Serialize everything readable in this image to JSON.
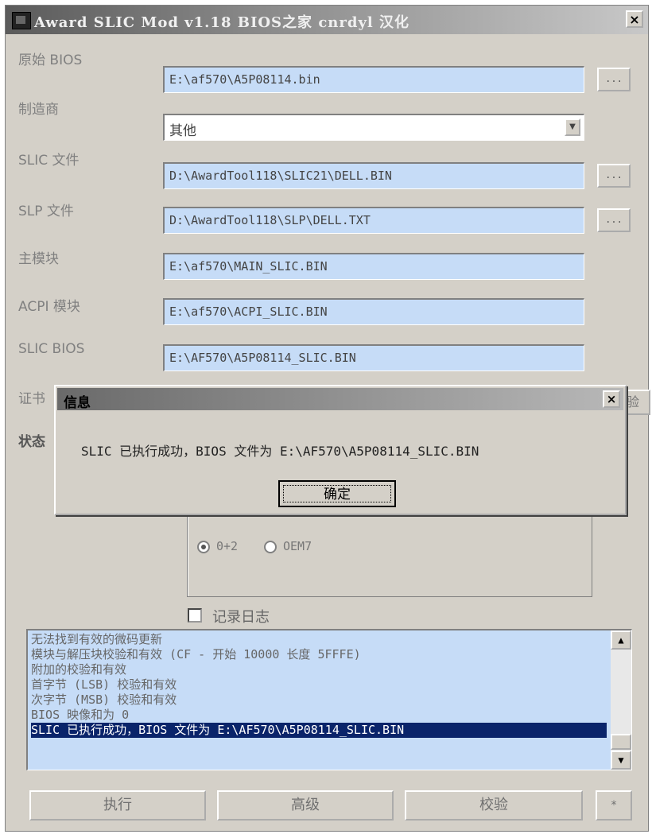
{
  "window": {
    "title": "Award SLIC Mod v1.18  BIOS之家 cnrdyl 汉化",
    "close": "×"
  },
  "fields": [
    {
      "label": "原始 BIOS",
      "value": "E:\\af570\\A5P08114.bin",
      "browse": "..."
    },
    {
      "label": "制造商",
      "value": "其他"
    },
    {
      "label": "SLIC 文件",
      "value": "D:\\AwardTool118\\SLIC21\\DELL.BIN",
      "browse": "..."
    },
    {
      "label": "SLP 文件",
      "value": "D:\\AwardTool118\\SLP\\DELL.TXT",
      "browse": "..."
    },
    {
      "label": "主模块",
      "value": "E:\\af570\\MAIN_SLIC.BIN"
    },
    {
      "label": "ACPI 模块",
      "value": "E:\\af570\\ACPI_SLIC.BIN"
    },
    {
      "label": "SLIC BIOS",
      "value": "E:\\AF570\\A5P08114_SLIC.BIN"
    }
  ],
  "partial_labels": {
    "cert": "证书",
    "status": "状态",
    "side_button": "验"
  },
  "options": {
    "radio1": "0+2",
    "radio2": "OEM7",
    "selected": "0+2",
    "log_checkbox": "记录日志"
  },
  "log": [
    "无法找到有效的微码更新",
    "模块与解压块校验和有效 (CF - 开始 10000 长度 5FFFE)",
    "附加的校验和有效",
    "首字节 (LSB) 校验和有效",
    "次字节 (MSB) 校验和有效",
    "BIOS 映像和为 0",
    "SLIC 已执行成功，BIOS 文件为 E:\\AF570\\A5P08114_SLIC.BIN"
  ],
  "buttons": {
    "execute": "执行",
    "advanced": "高级",
    "verify": "校验",
    "extra": "*"
  },
  "dialog": {
    "title": "信息",
    "message": "SLIC 已执行成功，BIOS 文件为 E:\\AF570\\A5P08114_SLIC.BIN",
    "ok": "确定",
    "close": "×"
  }
}
